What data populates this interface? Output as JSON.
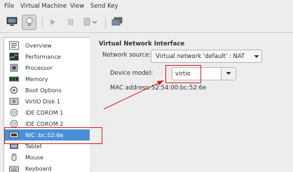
{
  "menu": [
    "File",
    "Virtual Machine",
    "View",
    "Send Key"
  ],
  "toolbar": {
    "buttons": [
      {
        "name": "console-icon",
        "pressed": false
      },
      {
        "name": "lightbulb-icon",
        "pressed": true
      },
      {
        "name": "run-icon",
        "pressed": false
      },
      {
        "name": "pause-icon",
        "pressed": false
      },
      {
        "name": "power-icon",
        "pressed": false
      },
      {
        "name": "fullscreen-icon",
        "pressed": false
      }
    ]
  },
  "sidebar": {
    "items": [
      {
        "label": "Overview",
        "icon": "overview-icon"
      },
      {
        "label": "Performance",
        "icon": "performance-icon"
      },
      {
        "label": "Processor",
        "icon": "processor-icon"
      },
      {
        "label": "Memory",
        "icon": "memory-icon"
      },
      {
        "label": "Boot Options",
        "icon": "boot-options-icon"
      },
      {
        "label": "VirtIO Disk 1",
        "icon": "disk-icon"
      },
      {
        "label": "IDE CDROM 1",
        "icon": "cdrom-icon"
      },
      {
        "label": "IDE CDROM 2",
        "icon": "cdrom-icon"
      },
      {
        "label": "NIC :bc:52:6e",
        "icon": "nic-icon",
        "selected": true
      },
      {
        "label": "Tablet",
        "icon": "tablet-icon"
      },
      {
        "label": "Mouse",
        "icon": "mouse-icon"
      },
      {
        "label": "Keyboard",
        "icon": "keyboard-icon"
      }
    ]
  },
  "detail": {
    "title": "Virtual Network Interface",
    "network_source_label": "Network source:",
    "network_source_value": "Virtual network 'default' : NAT",
    "device_model_label": "Device model:",
    "device_model_value": "virtio",
    "mac_label": "MAC address:",
    "mac_value": "52:54:00:bc:52:6e"
  },
  "colors": {
    "selection": "#4a90d9",
    "annotation": "#d22020"
  }
}
